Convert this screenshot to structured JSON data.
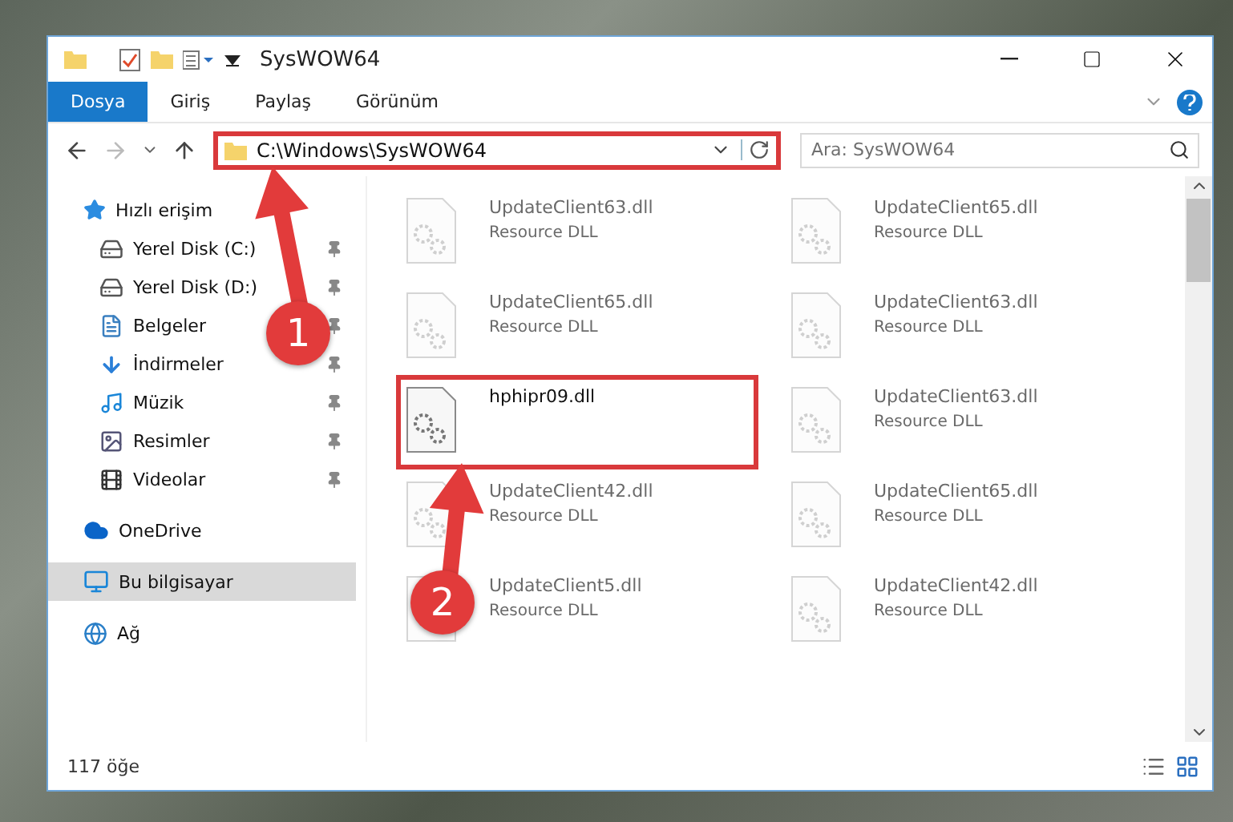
{
  "window": {
    "title": "SysWOW64"
  },
  "ribbon_tabs": [
    {
      "label": "Dosya",
      "selected": true
    },
    {
      "label": "Giriş",
      "selected": false
    },
    {
      "label": "Paylaş",
      "selected": false
    },
    {
      "label": "Görünüm",
      "selected": false
    }
  ],
  "address": {
    "path": "C:\\Windows\\SysWOW64",
    "highlighted": true
  },
  "search": {
    "placeholder": "Ara: SysWOW64"
  },
  "sidebar": {
    "items": [
      {
        "label": "Hızlı erişim",
        "selected": false,
        "children": [
          {
            "label": "Yerel Disk (C:)",
            "pinned": true,
            "selected": false
          },
          {
            "label": "Yerel Disk (D:)",
            "pinned": true,
            "selected": false
          },
          {
            "label": "Belgeler",
            "pinned": true,
            "selected": false
          },
          {
            "label": "İndirmeler",
            "pinned": true,
            "selected": false
          },
          {
            "label": "Müzik",
            "pinned": true,
            "selected": false
          },
          {
            "label": "Resimler",
            "pinned": true,
            "selected": false
          },
          {
            "label": "Videolar",
            "pinned": true,
            "selected": false
          }
        ]
      },
      {
        "label": "OneDrive",
        "selected": false
      },
      {
        "label": "Bu bilgisayar",
        "selected": true
      },
      {
        "label": "Ağ",
        "selected": false
      }
    ]
  },
  "files": [
    {
      "name": "UpdateClient63.dll",
      "type": "Resource DLL",
      "blurred": true,
      "highlighted": false
    },
    {
      "name": "UpdateClient65.dll",
      "type": "Resource DLL",
      "blurred": true,
      "highlighted": false
    },
    {
      "name": "UpdateClient65.dll",
      "type": "Resource DLL",
      "blurred": true,
      "highlighted": false
    },
    {
      "name": "UpdateClient63.dll",
      "type": "Resource DLL",
      "blurred": true,
      "highlighted": false
    },
    {
      "name": "hphipr09.dll",
      "blurred": false,
      "highlighted": true
    },
    {
      "name": "UpdateClient63.dll",
      "type": "Resource DLL",
      "blurred": true,
      "highlighted": false
    },
    {
      "name": "UpdateClient42.dll",
      "type": "Resource DLL",
      "blurred": true,
      "highlighted": false
    },
    {
      "name": "UpdateClient65.dll",
      "type": "Resource DLL",
      "blurred": true,
      "highlighted": false
    },
    {
      "name": "UpdateClient5.dll",
      "type": "Resource DLL",
      "blurred": true,
      "highlighted": false
    },
    {
      "name": "UpdateClient42.dll",
      "type": "Resource DLL",
      "blurred": true,
      "highlighted": false
    }
  ],
  "status_bar": {
    "count": "117 öğe"
  },
  "callouts": [
    {
      "number": "1"
    },
    {
      "number": "2"
    }
  ]
}
